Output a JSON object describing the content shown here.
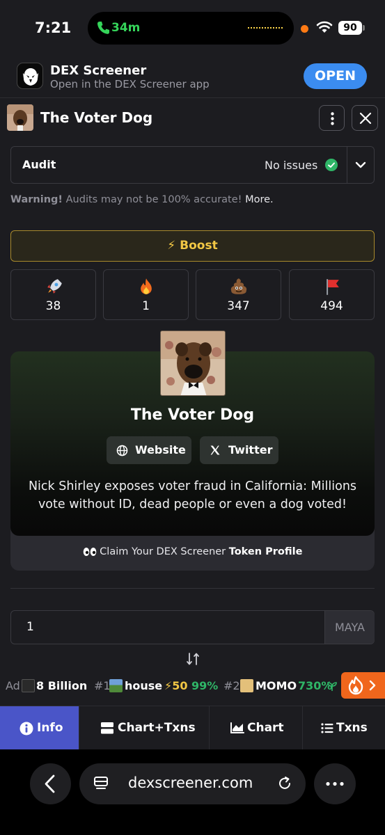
{
  "status_bar": {
    "time": "7:21",
    "call_time": "34m",
    "battery": "90"
  },
  "app_banner": {
    "name": "DEX Screener",
    "subtitle": "Open in the DEX Screener app",
    "open_label": "OPEN"
  },
  "token": {
    "title": "The Voter Dog"
  },
  "audit": {
    "label": "Audit",
    "value": "No issues",
    "warning_bold": "Warning!",
    "warning_text": " Audits may not be 100% accurate! ",
    "warning_more": "More."
  },
  "boost": {
    "icon": "⚡",
    "label": "Boost"
  },
  "reactions": [
    {
      "icon": "rocket-icon",
      "count": "38"
    },
    {
      "icon": "fire-icon",
      "count": "1"
    },
    {
      "icon": "poop-icon",
      "count": "347"
    },
    {
      "icon": "red-flag-icon",
      "count": "494"
    }
  ],
  "profile": {
    "name": "The Voter Dog",
    "website_label": "Website",
    "twitter_label": "Twitter",
    "description": "Nick Shirley exposes voter fraud in California: Millions vote without ID, dead people or even a dog voted!",
    "claim_prefix": "Claim Your DEX Screener ",
    "claim_bold": "Token Profile"
  },
  "amount": {
    "value": "1",
    "unit": "MAYA"
  },
  "ticker": {
    "ad_label": "Ad",
    "ad_name": "8 Billion",
    "items": [
      {
        "rank": "#1",
        "name": "house",
        "boost": "⚡50",
        "change": "99%"
      },
      {
        "rank": "#2",
        "name": "MOMO",
        "change": "730%"
      }
    ]
  },
  "tabs": [
    {
      "label": "Info",
      "active": true
    },
    {
      "label": "Chart+Txns"
    },
    {
      "label": "Chart"
    },
    {
      "label": "Txns"
    }
  ],
  "browser": {
    "url": "dexscreener.com"
  },
  "colors": {
    "background": "#1c1c20",
    "accent_blue": "#3b8cf0",
    "boost_gold": "#f2c744",
    "active_tab": "#4a55c8",
    "positive_green": "#2fb567",
    "fire_orange": "#f0661c"
  }
}
